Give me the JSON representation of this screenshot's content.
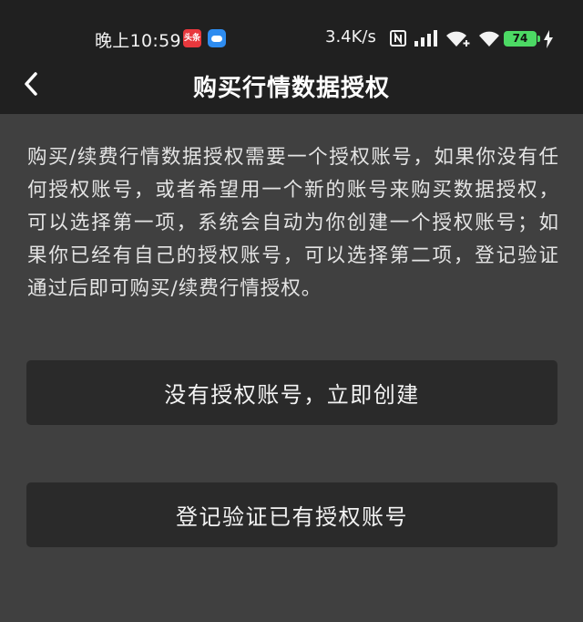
{
  "status_bar": {
    "time": "晚上10:59",
    "news_badge": "头条",
    "net_speed": "3.4K/s",
    "battery_level": "74",
    "icons": [
      "news-app-icon",
      "weather-app-icon",
      "nfc-icon",
      "signal-icon",
      "wifi-plus-icon",
      "wifi-icon",
      "battery-icon",
      "charging-icon"
    ]
  },
  "nav": {
    "back_icon": "chevron-left-icon",
    "title": "购买行情数据授权"
  },
  "main": {
    "description": "购买/续费行情数据授权需要一个授权账号，如果你没有任何授权账号，或者希望用一个新的账号来购买数据授权，可以选择第一项，系统会自动为你创建一个授权账号；如果你已经有自己的授权账号，可以选择第二项，登记验证通过后即可购买/续费行情授权。",
    "create_button_label": "没有授权账号，立即创建",
    "login_button_label": "登记验证已有授权账号"
  },
  "colors": {
    "header_bg": "#202020",
    "page_bg": "#404040",
    "button_bg": "#2a2a2a",
    "battery": "#4cd964"
  }
}
